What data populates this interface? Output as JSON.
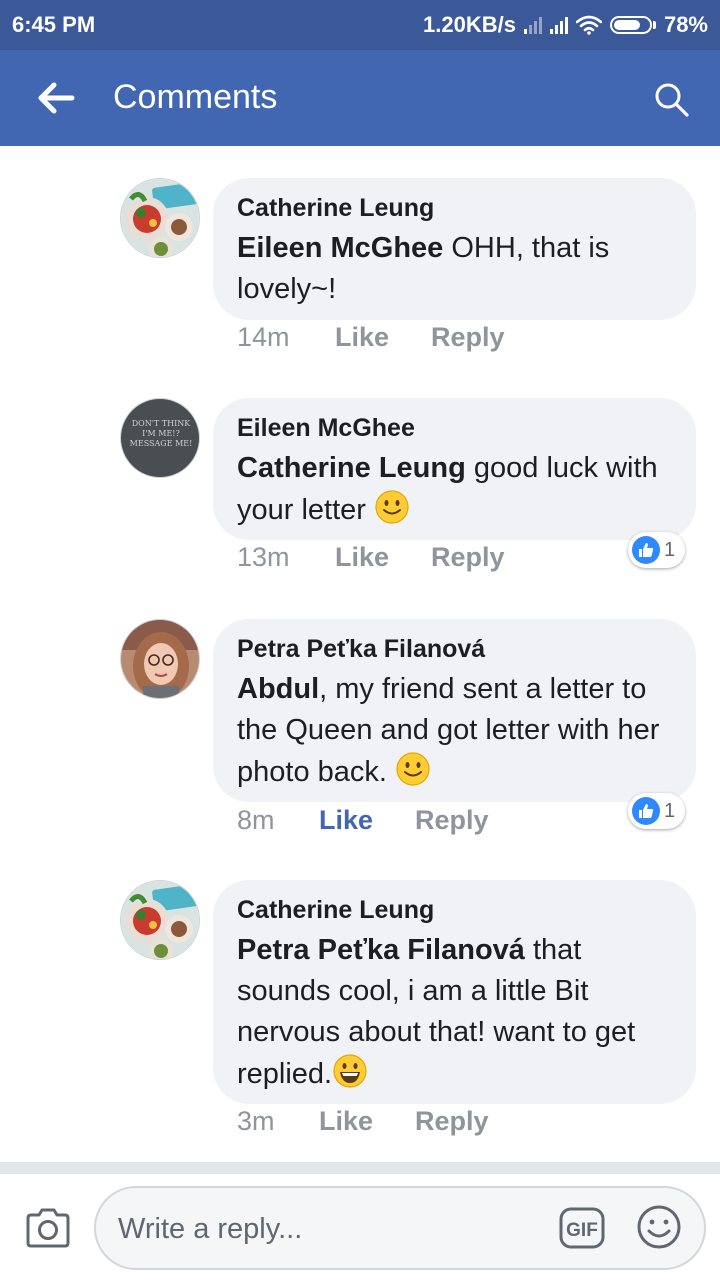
{
  "status_bar": {
    "time": "6:45 PM",
    "net_speed": "1.20KB/s",
    "battery_percent": "78%",
    "battery_level": 0.78
  },
  "app_bar": {
    "title": "Comments",
    "back_icon": "arrow-left-icon",
    "search_icon": "search-icon"
  },
  "comments": [
    {
      "author": "Catherine Leung",
      "mention": "Eileen McGhee",
      "text": " OHH, that is lovely~!",
      "time": "14m",
      "like_label": "Like",
      "reply_label": "Reply",
      "like_active": false
    },
    {
      "author": "Eileen McGhee",
      "mention": "Catherine Leung",
      "text": " good luck with your letter ",
      "emoji": "slightly-smiling-face-icon",
      "time": "13m",
      "like_label": "Like",
      "reply_label": "Reply",
      "like_active": false,
      "reaction_count": "1",
      "avatar_text": [
        "DON'T THINK",
        "I'M ME!?",
        "MESSAGE ME!"
      ]
    },
    {
      "author": "Petra Peťka Filanová",
      "mention": "Abdul",
      "text": ", my friend sent a letter to the Queen and got letter with her photo back. ",
      "emoji": "slightly-smiling-face-icon",
      "time": "8m",
      "like_label": "Like",
      "reply_label": "Reply",
      "like_active": true,
      "reaction_count": "1"
    },
    {
      "author": "Catherine Leung",
      "mention": "Petra Peťka Filanová",
      "text": " that sounds cool, i am a little Bit nervous about that! want to get replied.",
      "emoji": "grinning-face-icon",
      "time": "3m",
      "like_label": "Like",
      "reply_label": "Reply",
      "like_active": false
    }
  ],
  "composer": {
    "placeholder": "Write a reply...",
    "gif_label": "GIF",
    "camera_icon": "camera-icon",
    "emoji_icon": "emoji-picker-icon"
  },
  "colors": {
    "status_bar": "#3b5998",
    "app_bar": "#4267b2",
    "bubble": "#f1f2f5",
    "meta_text": "#90949c",
    "like_active": "#4267b2",
    "like_badge": "#2e89ff"
  }
}
